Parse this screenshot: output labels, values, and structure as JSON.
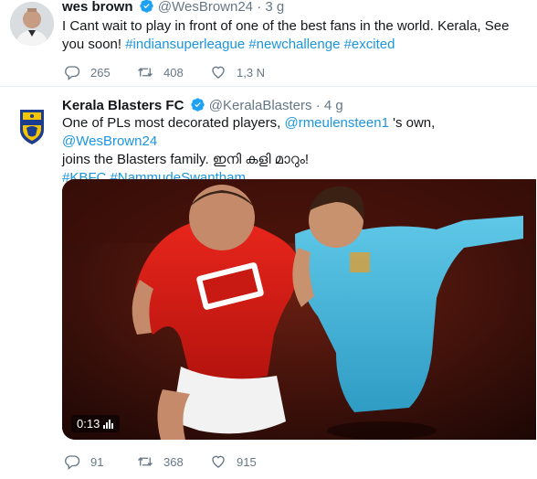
{
  "tweets": [
    {
      "name": "wes brown",
      "handle": "@WesBrown24",
      "dot": "·",
      "time": "3 g",
      "text_plain_1": "I Cant wait to play in front of one of the best fans in the world. Kerala, See you soon! ",
      "hashtags": [
        "#indiansuperleague",
        "#newchallenge",
        "#excited"
      ],
      "replies": "265",
      "retweets": "408",
      "likes": "1,3 N"
    },
    {
      "name": "Kerala Blasters FC",
      "handle": "@KeralaBlasters",
      "dot": "·",
      "time": "4 g",
      "text_a": "One of PLs most decorated players, ",
      "mention_1": "@rmeulensteen1",
      "text_b": " 's own, ",
      "mention_2": "@WesBrown24",
      "text_c": "joins the Blasters family. ഇനി കളി മാറും!",
      "hashtags": [
        "#KBFC",
        "#NammudeSwantham"
      ],
      "video_duration": "0:13",
      "replies": "91",
      "retweets": "368",
      "likes": "915"
    }
  ],
  "colors": {
    "link": "#1b95e0",
    "verified": "#1da1f2",
    "meta": "#657786"
  }
}
